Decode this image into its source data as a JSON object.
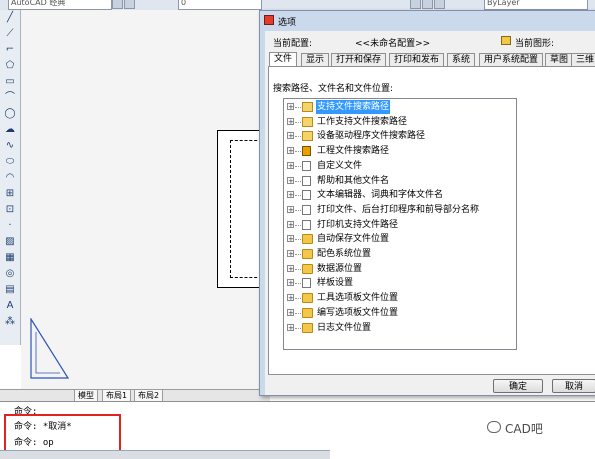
{
  "topbar": {
    "workspace": "AutoCAD 经典",
    "layer_combo": "0",
    "linetype_combo": "ByLayer"
  },
  "layout_tabs": [
    "模型",
    "布局1",
    "布局2"
  ],
  "command_lines": [
    "命令:",
    "命令: *取消*",
    "命令: op"
  ],
  "dialog": {
    "title": "选项",
    "current_profile_label": "当前配置:",
    "current_profile_value": "<<未命名配置>>",
    "current_drawing_label": "当前图形:",
    "tabs": [
      "文件",
      "显示",
      "打开和保存",
      "打印和发布",
      "系统",
      "用户系统配置",
      "草图",
      "三维"
    ],
    "active_tab": "文件",
    "panel_title": "搜索路径、文件名和文件位置:",
    "tree_items": [
      {
        "label": "支持文件搜索路径",
        "icon": "folder-open-icon",
        "selected": true
      },
      {
        "label": "工作支持文件搜索路径",
        "icon": "folder-open-icon"
      },
      {
        "label": "设备驱动程序文件搜索路径",
        "icon": "folder-open-icon"
      },
      {
        "label": "工程文件搜索路径",
        "icon": "project-icon"
      },
      {
        "label": "自定义文件",
        "icon": "document-icon"
      },
      {
        "label": "帮助和其他文件名",
        "icon": "document-icon"
      },
      {
        "label": "文本编辑器、词典和字体文件名",
        "icon": "document-icon"
      },
      {
        "label": "打印文件、后台打印程序和前导部分名称",
        "icon": "document-icon"
      },
      {
        "label": "打印机支持文件路径",
        "icon": "document-icon"
      },
      {
        "label": "自动保存文件位置",
        "icon": "folder-icon"
      },
      {
        "label": "配色系统位置",
        "icon": "folder-icon"
      },
      {
        "label": "数据源位置",
        "icon": "folder-icon"
      },
      {
        "label": "样板设置",
        "icon": "document-icon"
      },
      {
        "label": "工具选项板文件位置",
        "icon": "folder-icon"
      },
      {
        "label": "编写选项板文件位置",
        "icon": "folder-icon"
      },
      {
        "label": "日志文件位置",
        "icon": "folder-icon"
      }
    ],
    "ok_button": "确定",
    "cancel_button": "取消"
  },
  "watermark": "CAD吧",
  "colors": {
    "highlight_box": "#e3221f",
    "selection": "#3399ff",
    "dialog_frame": "#cad9ec"
  }
}
